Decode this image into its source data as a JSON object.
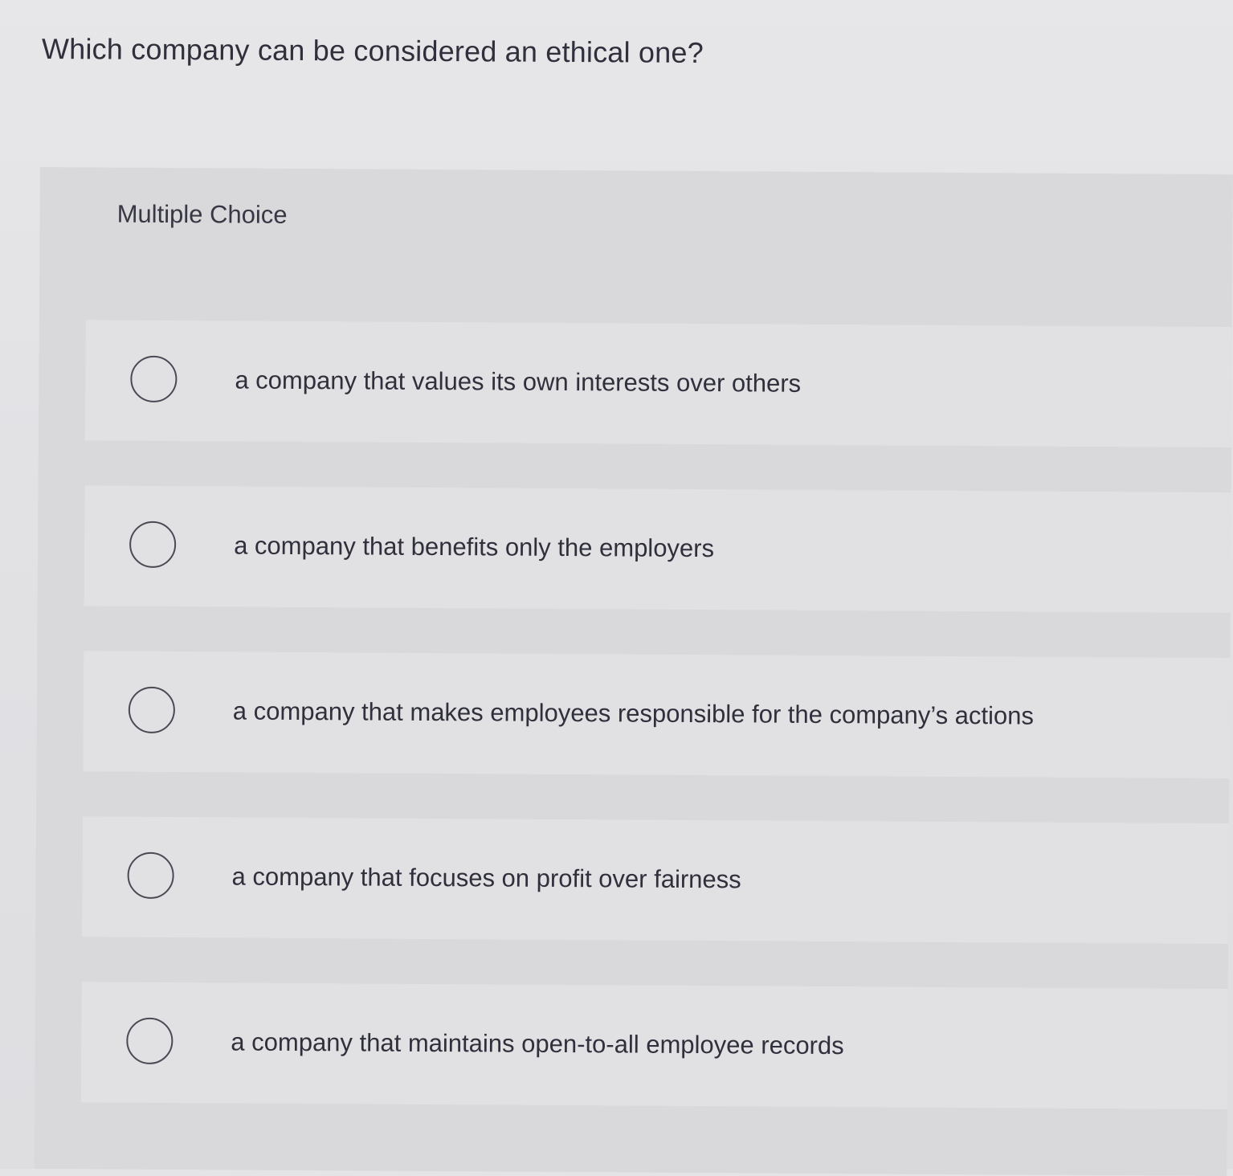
{
  "question": {
    "text": "Which company can be considered an ethical one?"
  },
  "panel": {
    "label": "Multiple Choice"
  },
  "options": [
    {
      "label": "a company that values its own interests over others",
      "selected": false
    },
    {
      "label": "a company that benefits only the employers",
      "selected": false
    },
    {
      "label": "a company that makes employees responsible for the company’s actions",
      "selected": false
    },
    {
      "label": "a company that focuses on profit over fairness",
      "selected": false
    },
    {
      "label": "a company that maintains open-to-all employee records",
      "selected": false
    }
  ]
}
